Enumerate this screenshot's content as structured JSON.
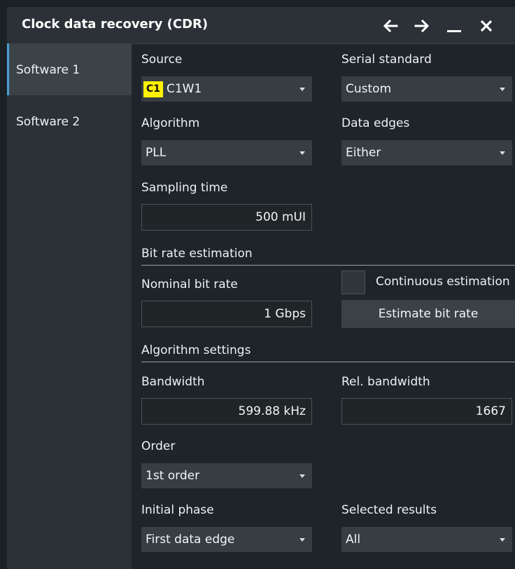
{
  "window": {
    "title": "Clock data recovery (CDR)",
    "icons": [
      "arrow-left-icon",
      "arrow-right-icon",
      "minimize-icon",
      "close-icon"
    ]
  },
  "sidebar": {
    "items": [
      {
        "label": "Software 1",
        "active": true
      },
      {
        "label": "Software 2",
        "active": false
      }
    ]
  },
  "source": {
    "label": "Source",
    "badge": "C1",
    "badge_color": "#fff200",
    "value": "C1W1"
  },
  "serial_standard": {
    "label": "Serial standard",
    "value": "Custom"
  },
  "algorithm": {
    "label": "Algorithm",
    "value": "PLL"
  },
  "data_edges": {
    "label": "Data edges",
    "value": "Either"
  },
  "sampling_time": {
    "label": "Sampling time",
    "value": "500 mUI"
  },
  "bit_rate_estimation": {
    "section": "Bit rate estimation",
    "nominal_label": "Nominal bit rate",
    "nominal_value": "1 Gbps",
    "continuous_label": "Continuous estimation",
    "continuous_checked": false,
    "estimate_button": "Estimate bit rate"
  },
  "algorithm_settings": {
    "section": "Algorithm settings",
    "bandwidth_label": "Bandwidth",
    "bandwidth_value": "599.88 kHz",
    "rel_bandwidth_label": "Rel. bandwidth",
    "rel_bandwidth_value": "1667",
    "order_label": "Order",
    "order_value": "1st order",
    "initial_phase_label": "Initial phase",
    "initial_phase_value": "First data edge",
    "selected_results_label": "Selected results",
    "selected_results_value": "All"
  },
  "colors": {
    "accent": "#4aa0d8",
    "badge": "#fff200",
    "background": "#1e2429"
  }
}
